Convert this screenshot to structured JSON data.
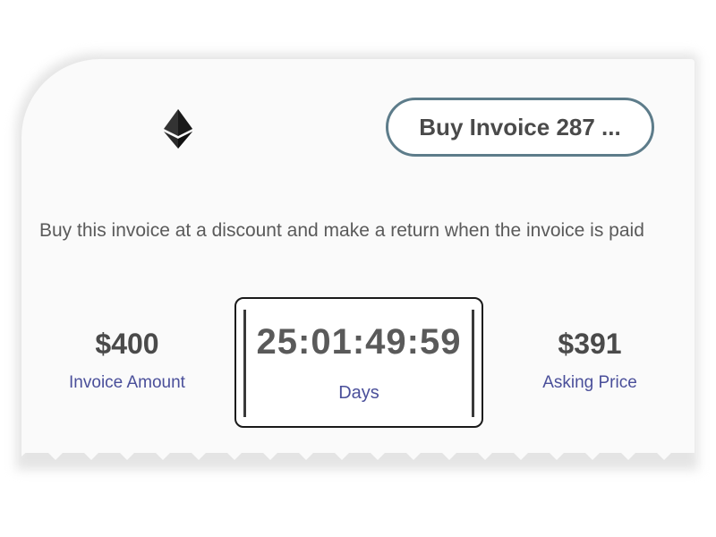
{
  "card": {
    "logo_icon": "ethereum-icon",
    "buy_button_label": "Buy Invoice 287 ...",
    "description": "Buy this invoice at a discount and make a return when the invoice is paid",
    "invoice_amount": {
      "value": "$400",
      "label": "Invoice Amount"
    },
    "countdown": {
      "value": "25:01:49:59",
      "label": "Days"
    },
    "asking_price": {
      "value": "$391",
      "label": "Asking Price"
    }
  },
  "colors": {
    "button_border": "#5d7c8a",
    "label_accent": "#4a4f9a",
    "text_dark": "#4a4a4a"
  }
}
